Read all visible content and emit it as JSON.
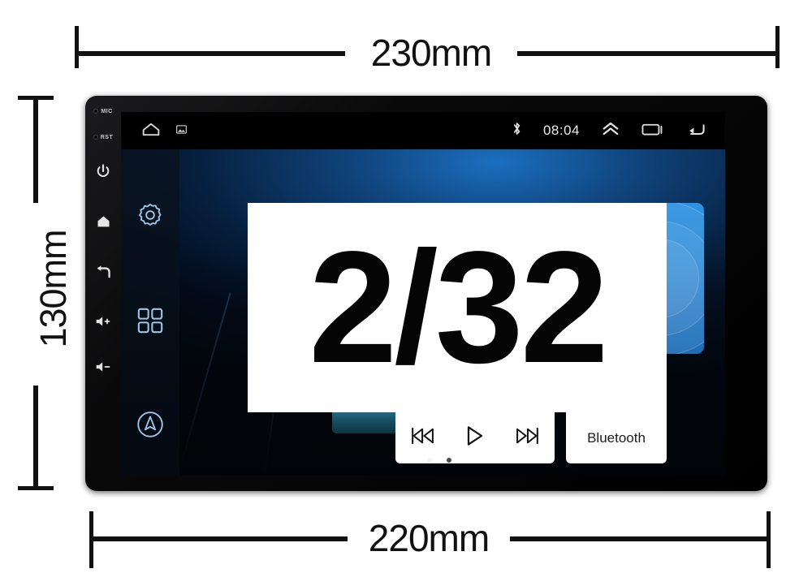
{
  "dimensions": {
    "top": "230mm",
    "bottom": "220mm",
    "left": "130mm"
  },
  "device": {
    "side_buttons": [
      {
        "name": "mic",
        "label": "MIC"
      },
      {
        "name": "reset",
        "label": "RST"
      },
      {
        "name": "power",
        "label": ""
      },
      {
        "name": "home",
        "label": ""
      },
      {
        "name": "back",
        "label": ""
      },
      {
        "name": "volume-up",
        "label": ""
      },
      {
        "name": "volume-down",
        "label": ""
      }
    ]
  },
  "status_bar": {
    "home_icon": "home-icon",
    "gallery_icon": "gallery-icon",
    "bluetooth_icon": "bluetooth-icon",
    "clock": "08:04",
    "chevron_up_icon": "chevron-up-icon",
    "recents_icon": "recent-apps-icon",
    "back_icon": "back-arrow-icon"
  },
  "dock": [
    {
      "name": "settings",
      "icon": "gear-icon"
    },
    {
      "name": "apps",
      "icon": "grid-apps-icon"
    },
    {
      "name": "navigation",
      "icon": "navigation-compass-icon"
    }
  ],
  "widgets": {
    "bluetooth_tile": {
      "icon": "bluetooth-phone-icon",
      "label": "Bluetooth"
    },
    "media": {
      "previous_icon": "skip-previous-icon",
      "play_icon": "play-icon",
      "next_icon": "skip-next-icon"
    }
  },
  "overlay": {
    "spec_text": "2/32"
  },
  "page_indicator": {
    "total": 2,
    "active": 1
  },
  "colors": {
    "accent_blue": "#2f92e0",
    "screen_bg_blue": "#10447c",
    "bezel": "#000000",
    "panel_white": "#ffffff"
  }
}
